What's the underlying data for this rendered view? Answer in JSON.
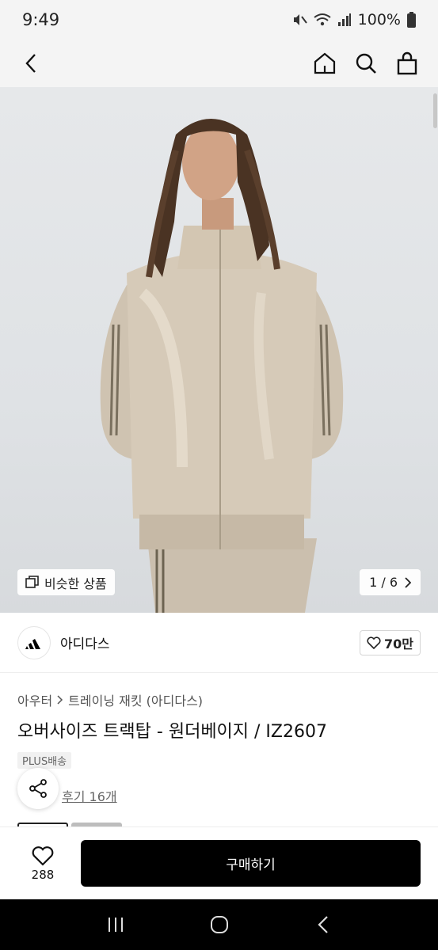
{
  "status_bar": {
    "time": "9:49",
    "battery": "100%"
  },
  "top_nav": {
    "back_icon": "chevron-left-icon",
    "home_icon": "home-icon",
    "search_icon": "search-icon",
    "cart_icon": "shopping-bag-icon"
  },
  "hero": {
    "similar_label": "비슷한 상품",
    "pager": "1 / 6"
  },
  "brand": {
    "name": "아디다스",
    "like_count": "70만"
  },
  "product": {
    "breadcrumb": [
      "아우터",
      "트레이닝 재킷 (아디다스)"
    ],
    "title": "오버사이즈 트랙탑 - 원더베이지 / IZ2607",
    "badge": "PLUS배송",
    "reviews": "후기 16개"
  },
  "bottom_bar": {
    "wish_count": "288",
    "buy_label": "구매하기"
  },
  "colors": {
    "accent": "#000000",
    "hero_bg": "#e2e5e8",
    "jacket": "#cdbfa9"
  }
}
